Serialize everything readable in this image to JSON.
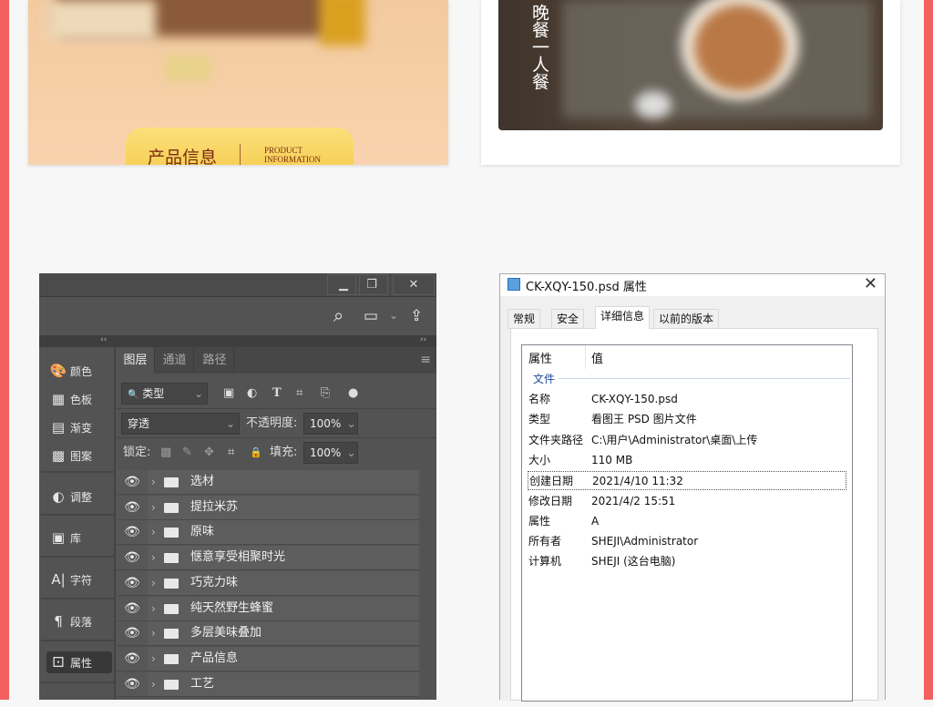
{
  "colors": {
    "page_border": "#f26060",
    "ps_bg": "#535353",
    "group_text": "#1e4a9a"
  },
  "card1": {
    "badge_cn": "产品信息",
    "badge_en_1": "PRODUCT",
    "badge_en_2": "INFORMATION"
  },
  "card2": {
    "title": "晚餐一人餐"
  },
  "photoshop": {
    "window_buttons": [
      {
        "icon": "minimize-icon",
        "glyph": "▁"
      },
      {
        "icon": "restore-icon",
        "glyph": "❐"
      },
      {
        "icon": "close-icon",
        "glyph": "✕"
      }
    ],
    "toolbar_icons": [
      {
        "icon": "search-icon",
        "glyph": "⌕"
      },
      {
        "icon": "workspace-icon",
        "glyph": "▭"
      },
      {
        "icon": "chevron-down-icon",
        "glyph": "⌄"
      },
      {
        "icon": "share-icon",
        "glyph": "⇪"
      }
    ],
    "collapse_left": "‹‹",
    "collapse_right": "››",
    "dock": [
      {
        "icon": "palette-icon",
        "glyph": "🎨",
        "label": "颜色"
      },
      {
        "icon": "swatches-icon",
        "glyph": "▦",
        "label": "色板"
      },
      {
        "icon": "gradient-icon",
        "glyph": "▤",
        "label": "渐变"
      },
      {
        "icon": "pattern-icon",
        "glyph": "▩",
        "label": "图案"
      },
      {
        "icon": "adjustments-icon",
        "glyph": "◐",
        "label": "调整"
      },
      {
        "icon": "libraries-icon",
        "glyph": "▣",
        "label": "库"
      },
      {
        "icon": "character-icon",
        "glyph": "A|",
        "label": "字符"
      },
      {
        "icon": "paragraph-icon",
        "glyph": "¶",
        "label": "段落"
      },
      {
        "icon": "properties-icon",
        "glyph": "⚀",
        "label": "属性"
      }
    ],
    "tabs": [
      "图层",
      "通道",
      "路径"
    ],
    "panel_menu_glyph": "≡",
    "filter": {
      "value": "类型",
      "search_glyph": "🔍",
      "chev": "⌄",
      "icons": [
        {
          "icon": "image-filter-icon",
          "glyph": "▣"
        },
        {
          "icon": "adjustment-filter-icon",
          "glyph": "◐"
        },
        {
          "icon": "type-filter-icon",
          "glyph": "T"
        },
        {
          "icon": "shape-filter-icon",
          "glyph": "⌗"
        },
        {
          "icon": "smart-object-filter-icon",
          "glyph": "⎘"
        },
        {
          "icon": "filter-toggle-icon",
          "glyph": "●"
        }
      ]
    },
    "blend_mode": "穿透",
    "opacity_label": "不透明度:",
    "opacity_value": "100%",
    "lock_label": "锁定:",
    "lock_icons": [
      {
        "icon": "lock-pixels-transparent-icon",
        "glyph": "▩"
      },
      {
        "icon": "brush-icon",
        "glyph": "✎"
      },
      {
        "icon": "move-icon",
        "glyph": "✥"
      },
      {
        "icon": "artboard-icon",
        "glyph": "⌗"
      },
      {
        "icon": "lock-icon",
        "glyph": "🔒"
      }
    ],
    "fill_label": "填充:",
    "fill_value": "100%",
    "layers": [
      "选材",
      "提拉米苏",
      "原味",
      "惬意享受相聚时光",
      "巧克力味",
      "纯天然野生蜂蜜",
      "多层美味叠加",
      "产品信息",
      "工艺"
    ],
    "eye_glyph": "👁",
    "chevron_glyph": "›"
  },
  "dialog": {
    "title": "CK-XQY-150.psd 属性",
    "close_glyph": "✕",
    "tabs": [
      "常规",
      "安全",
      "详细信息",
      "以前的版本"
    ],
    "col_property": "属性",
    "col_value": "值",
    "group": "文件",
    "rows": [
      {
        "k": "名称",
        "v": "CK-XQY-150.psd"
      },
      {
        "k": "类型",
        "v": "看图王 PSD 图片文件"
      },
      {
        "k": "文件夹路径",
        "v": "C:\\用户\\Administrator\\桌面\\上传"
      },
      {
        "k": "大小",
        "v": "110 MB"
      },
      {
        "k": "创建日期",
        "v": "2021/4/10 11:32"
      },
      {
        "k": "修改日期",
        "v": "2021/4/2 15:51"
      },
      {
        "k": "属性",
        "v": "A"
      },
      {
        "k": "所有者",
        "v": "SHEJI\\Administrator"
      },
      {
        "k": "计算机",
        "v": "SHEJI (这台电脑)"
      }
    ]
  }
}
